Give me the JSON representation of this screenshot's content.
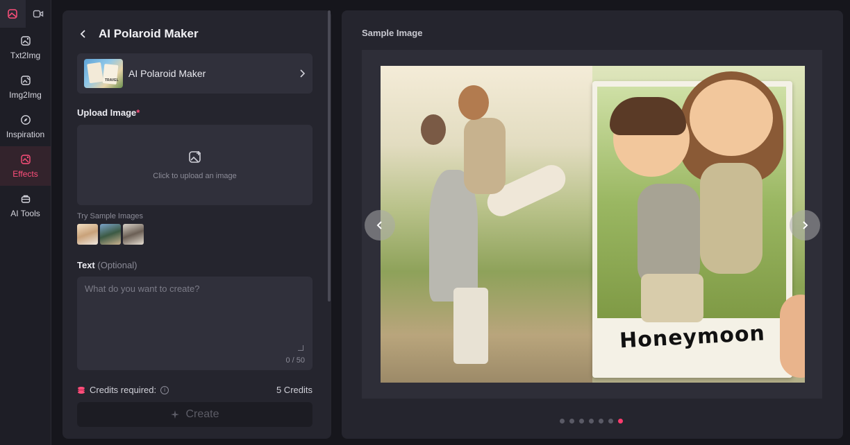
{
  "rail": {
    "modes": [
      {
        "name": "image-mode",
        "active": true
      },
      {
        "name": "video-mode",
        "active": false
      }
    ],
    "items": [
      {
        "label": "Txt2Img",
        "icon": "image-sparkle-icon",
        "active": false
      },
      {
        "label": "Img2Img",
        "icon": "image-edit-icon",
        "active": false
      },
      {
        "label": "Inspiration",
        "icon": "compass-icon",
        "active": false
      },
      {
        "label": "Effects",
        "icon": "effects-icon",
        "active": true
      },
      {
        "label": "AI Tools",
        "icon": "toolbox-icon",
        "active": false
      }
    ],
    "accent": "#ff4f7b"
  },
  "panel": {
    "title": "AI Polaroid Maker",
    "effect_card": {
      "name": "AI Polaroid Maker",
      "thumb_text": "TRAVEL"
    },
    "upload": {
      "label": "Upload Image",
      "required_mark": "*",
      "hint": "Click to upload an image"
    },
    "samples": {
      "label": "Try Sample Images",
      "count": 3
    },
    "text": {
      "label": "Text",
      "optional": "(Optional)",
      "placeholder": "What do you want to create?",
      "counter": "0 / 50"
    },
    "credits": {
      "label": "Credits required:",
      "value": "5 Credits"
    },
    "create_label": "Create"
  },
  "preview": {
    "title": "Sample Image",
    "caption": "Honeymoon",
    "dots_total": 7,
    "active_dot": 6
  }
}
